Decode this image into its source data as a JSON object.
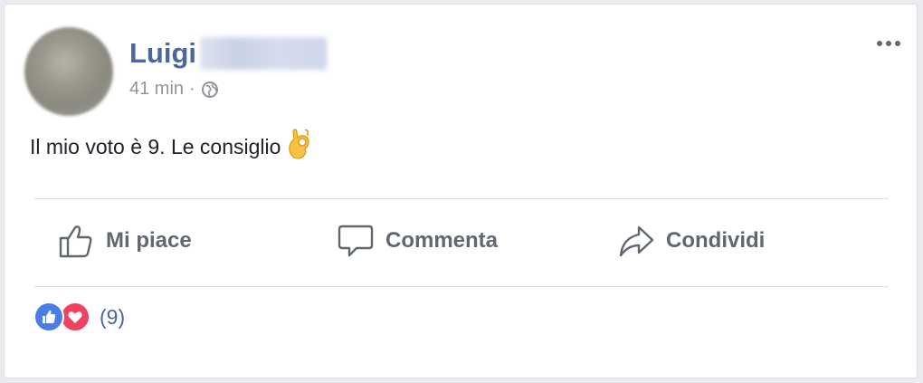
{
  "post": {
    "author_first_name": "Luigi",
    "timestamp": "41 min",
    "separator": "·",
    "privacy_icon": "globe-icon",
    "text": "Il mio voto è 9. Le consiglio",
    "emoji": "ok-hand-emoji"
  },
  "actions": {
    "like_label": "Mi piace",
    "comment_label": "Commenta",
    "share_label": "Condividi"
  },
  "reactions": {
    "types": [
      "like",
      "love"
    ],
    "count_label": "(9)"
  },
  "colors": {
    "author": "#4b67a1",
    "like": "#4a7de8",
    "love": "#ef4260",
    "action_text": "#606770"
  }
}
